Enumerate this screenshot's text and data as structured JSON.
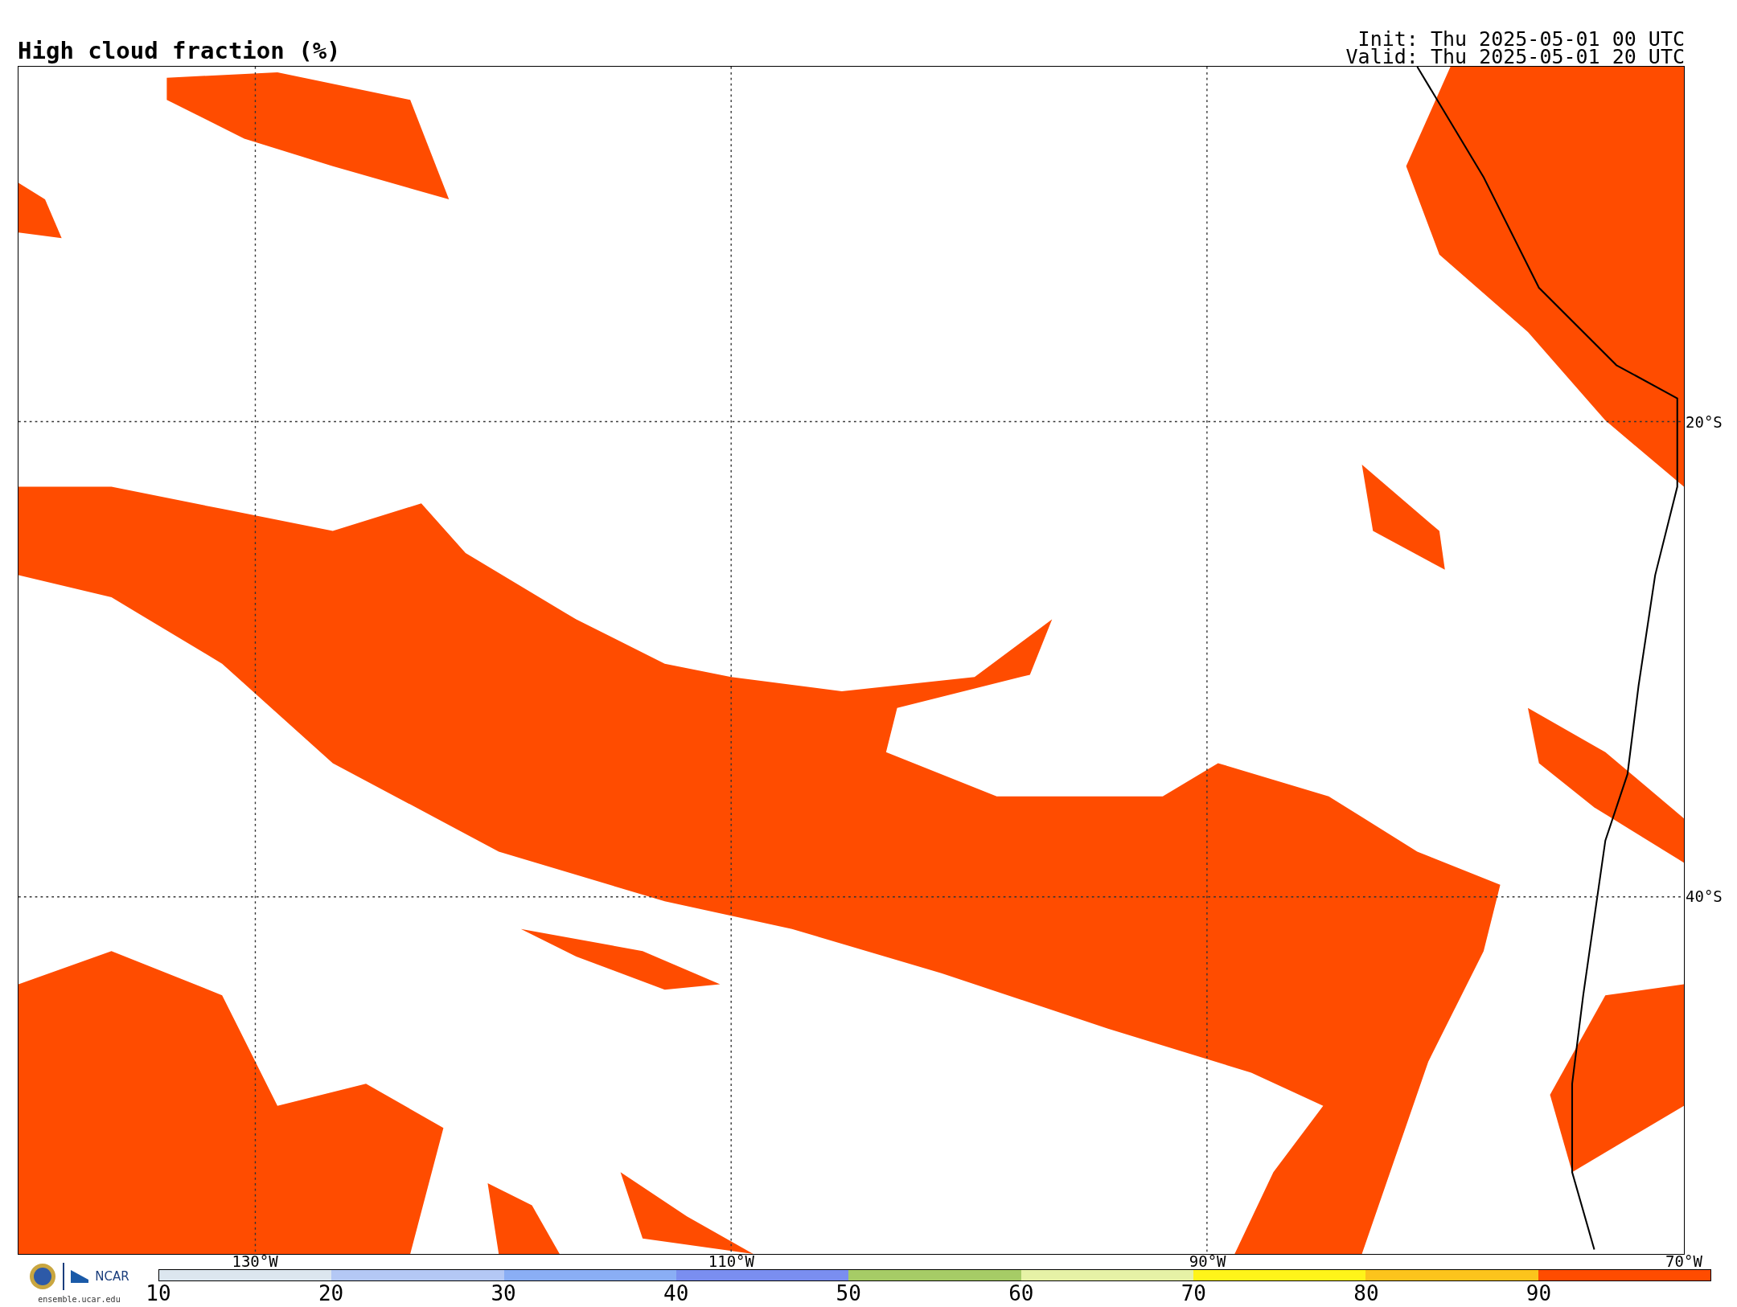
{
  "title": "High cloud fraction (%)",
  "init": "Init: Thu 2025-05-01 00 UTC",
  "valid": "Valid: Thu 2025-05-01 20 UTC",
  "map": {
    "lat_labels": [
      "20°S",
      "40°S"
    ],
    "lon_labels": [
      "130°W",
      "110°W",
      "90°W",
      "70°W"
    ]
  },
  "colorbar": {
    "segments": [
      {
        "label": "10",
        "color": "#dce6ef"
      },
      {
        "label": "20",
        "color": "#b4c8f5"
      },
      {
        "label": "30",
        "color": "#8aaef5"
      },
      {
        "label": "40",
        "color": "#7a8ef0"
      },
      {
        "label": "50",
        "color": "#a6cc66"
      },
      {
        "label": "60",
        "color": "#e6f2a6"
      },
      {
        "label": "70",
        "color": "#fff41a"
      },
      {
        "label": "80",
        "color": "#fcc41c"
      },
      {
        "label": "90",
        "color": "#ff4c00"
      }
    ]
  },
  "logo": {
    "brand": "NCAR",
    "site": "ensemble.ucar.edu"
  }
}
